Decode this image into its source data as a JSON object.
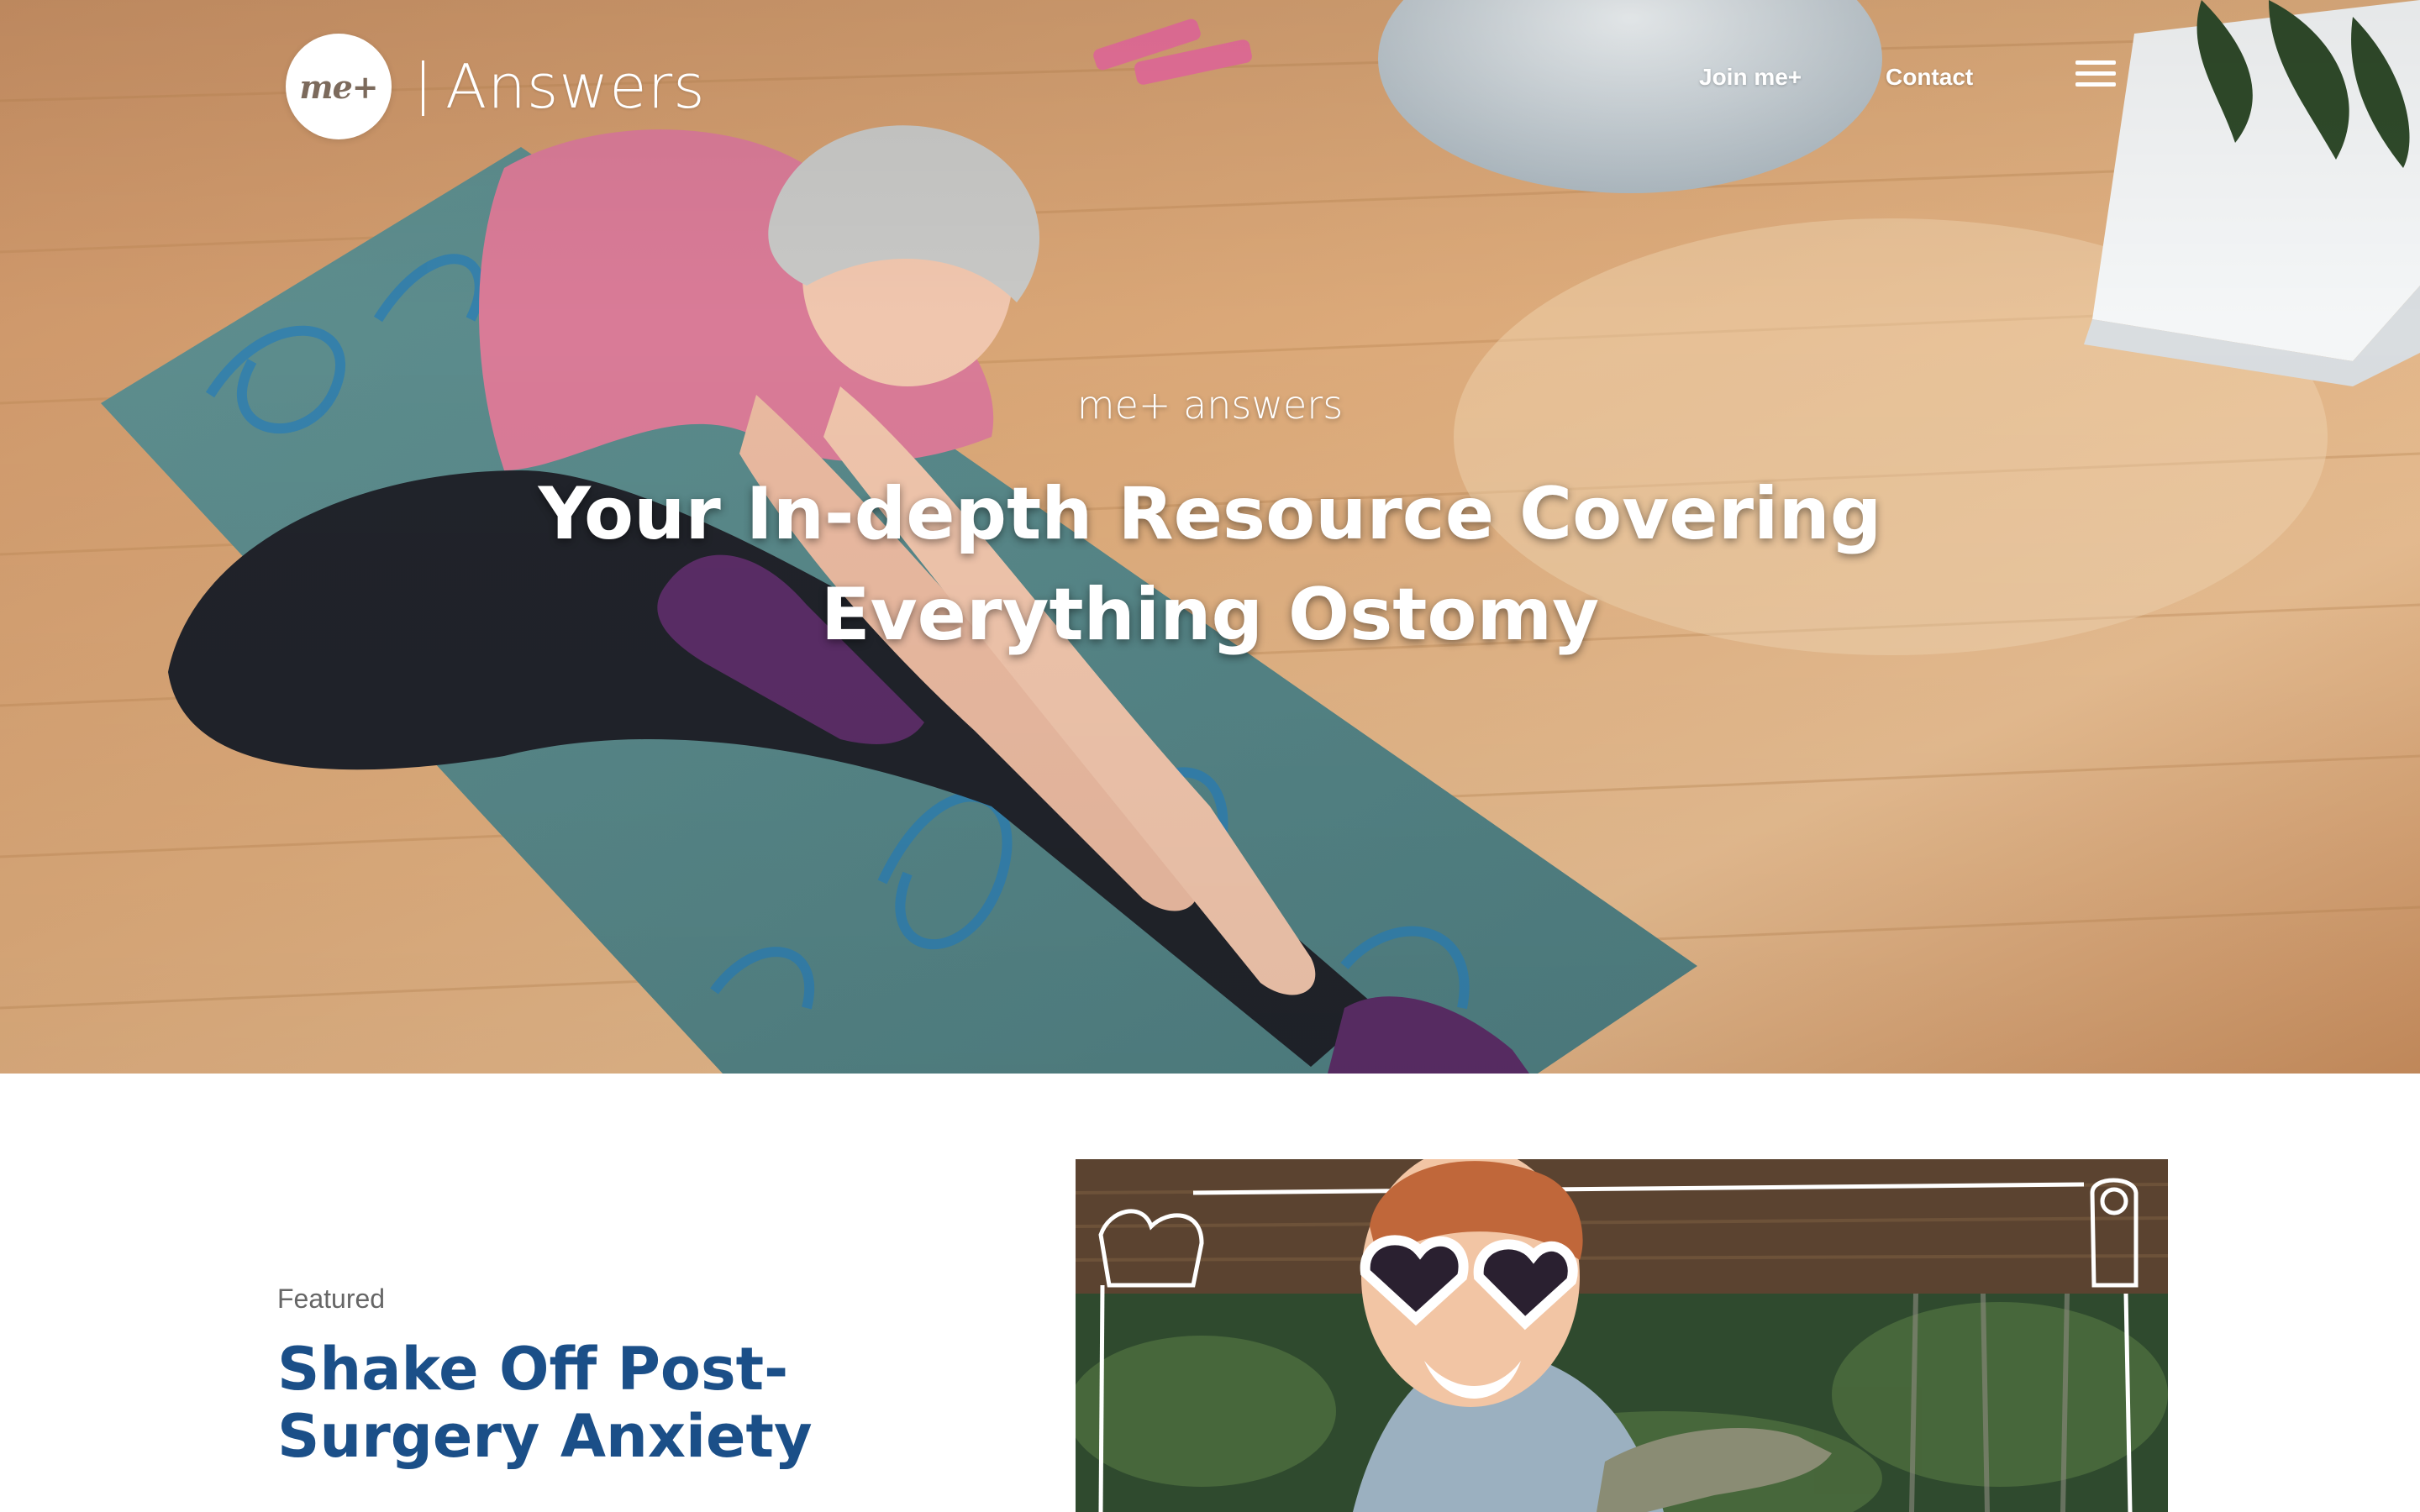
{
  "header": {
    "logo_text": "me+",
    "brand_word": "Answers",
    "nav": [
      {
        "label": "Join me+"
      },
      {
        "label": "Contact"
      }
    ],
    "menu_icon": "hamburger-menu-icon"
  },
  "hero": {
    "eyebrow": "me+ answers",
    "title": "Your In-depth Resource Covering Everything Ostomy",
    "image": "woman-stretching-on-yoga-mat-photo"
  },
  "featured": {
    "label": "Featured",
    "title": "Shake Off Post-Surgery Anxiety",
    "image": "smiling-woman-heart-sunglasses-photo"
  },
  "colors": {
    "featured_title": "#1b4f88",
    "featured_label": "#666666",
    "hero_text": "#ffffff"
  }
}
